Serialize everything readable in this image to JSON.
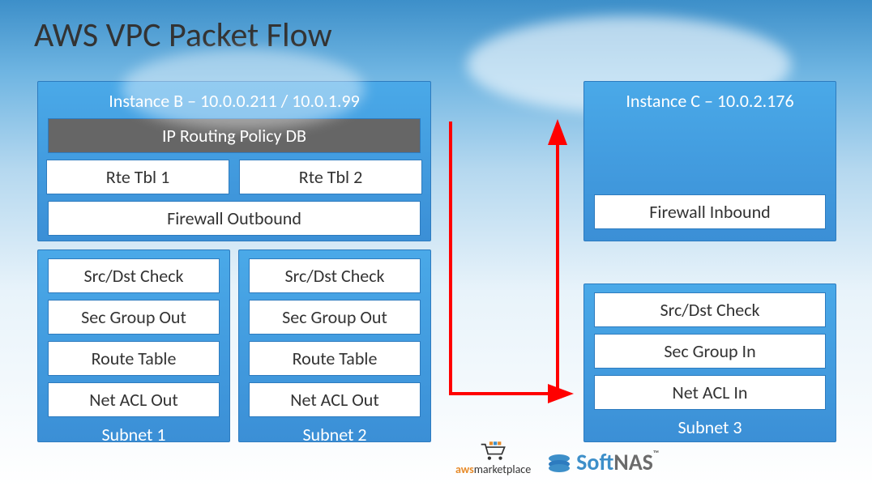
{
  "title": "AWS VPC Packet Flow",
  "instanceB": {
    "header": "Instance B – 10.0.0.211 / 10.0.1.99",
    "policyDb": "IP Routing Policy DB",
    "rteTbl1": "Rte Tbl 1",
    "rteTbl2": "Rte Tbl 2",
    "fwOut": "Firewall Outbound"
  },
  "instanceC": {
    "header": "Instance C – 10.0.2.176",
    "fwIn": "Firewall Inbound"
  },
  "subnet1": {
    "srcDst": "Src/Dst Check",
    "secGroup": "Sec Group Out",
    "routeTbl": "Route Table",
    "netAcl": "Net ACL Out",
    "footer": "Subnet 1"
  },
  "subnet2": {
    "srcDst": "Src/Dst Check",
    "secGroup": "Sec Group Out",
    "routeTbl": "Route Table",
    "netAcl": "Net ACL Out",
    "footer": "Subnet 2"
  },
  "subnet3": {
    "srcDst": "Src/Dst Check",
    "secGroup": "Sec Group In",
    "netAcl": "Net ACL In",
    "footer": "Subnet 3"
  },
  "logos": {
    "awsMarketplace1": "aws",
    "awsMarketplace2": "marketplace",
    "softnas1": "Soft",
    "softnas2": "NAS"
  },
  "colors": {
    "boxGradientTop": "#4aa9e8",
    "boxGradientBottom": "#3b8fd6",
    "arrow": "#ff0000"
  }
}
